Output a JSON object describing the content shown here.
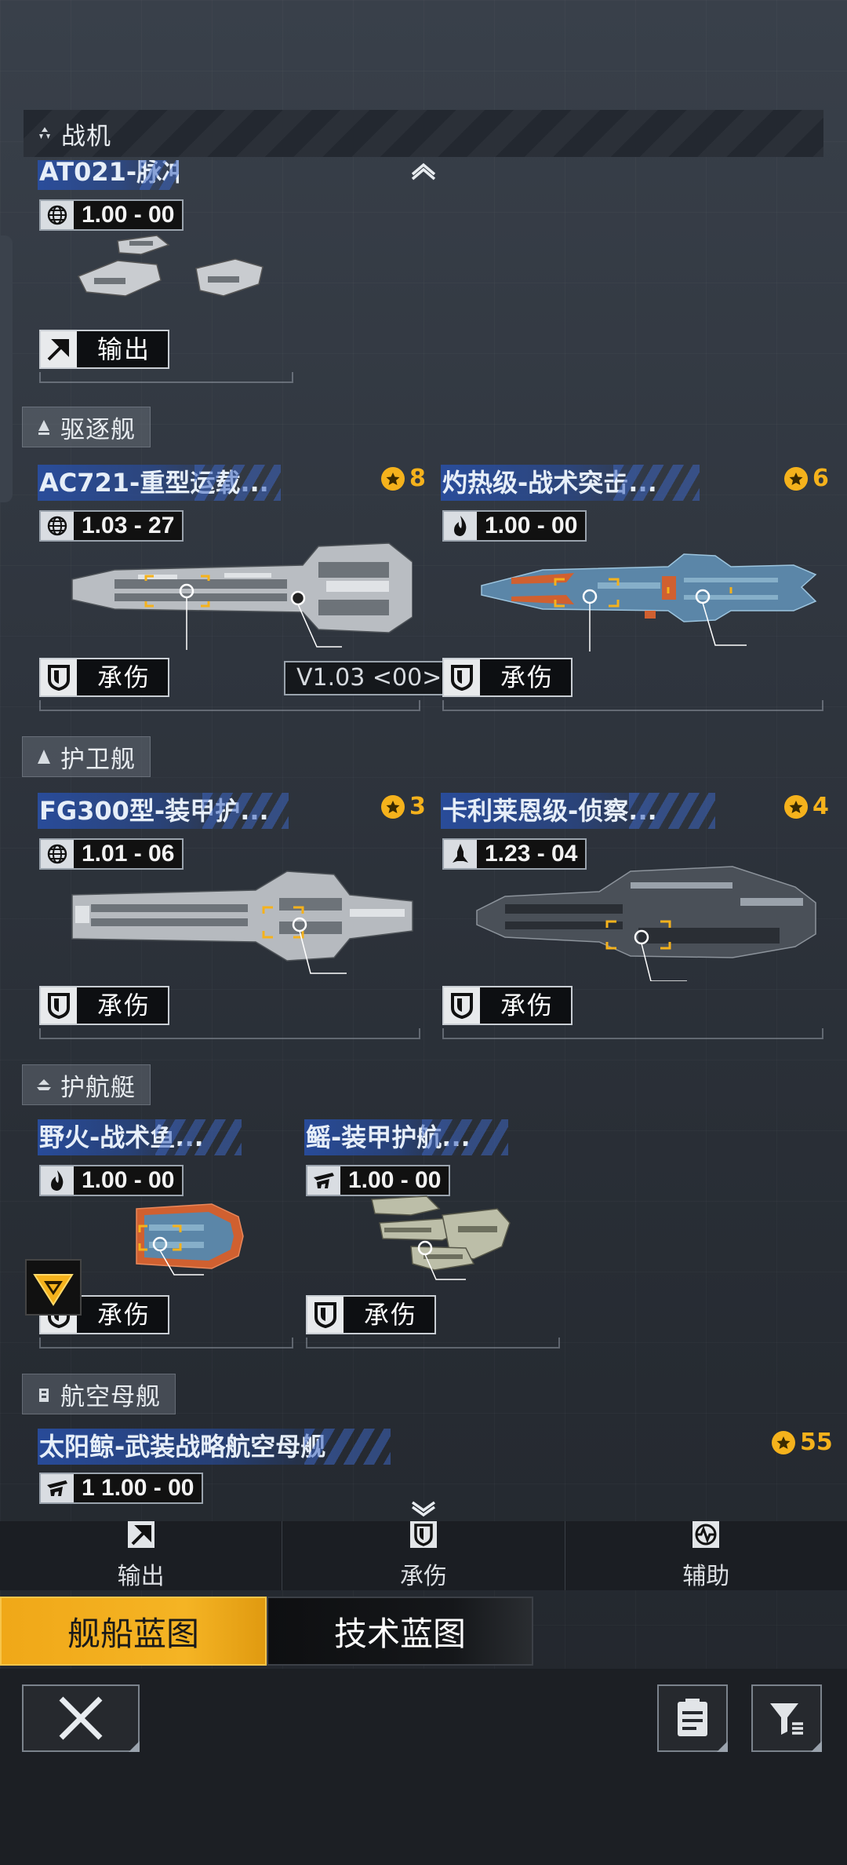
{
  "sections": {
    "fighter": "战机",
    "destroyer": "驱逐舰",
    "frigate": "护卫舰",
    "corvette": "护航艇",
    "carrier": "航空母舰"
  },
  "cards": {
    "fighter1": {
      "name": "AT021-脉冲...",
      "stat": "1.00 - 00",
      "role": "输出"
    },
    "destroyer1": {
      "name": "AC721-重型运载...",
      "rank": "8",
      "stat": "1.03 - 27",
      "role": "承伤",
      "version": "V1.03 <00>"
    },
    "destroyer2": {
      "name": "灼热级-战术突击...",
      "rank": "6",
      "stat": "1.00 - 00",
      "role": "承伤"
    },
    "frigate1": {
      "name": "FG300型-装甲护...",
      "rank": "3",
      "stat": "1.01 - 06",
      "role": "承伤"
    },
    "frigate2": {
      "name": "卡利莱恩级-侦察...",
      "rank": "4",
      "stat": "1.23 - 04",
      "role": "承伤"
    },
    "corvette1": {
      "name": "野火-战术鱼...",
      "stat": "1.00 - 00",
      "role": "承伤"
    },
    "corvette2": {
      "name": "鳐-装甲护航...",
      "stat": "1.00 - 00",
      "role": "承伤"
    },
    "carrier1": {
      "name": "太阳鲸-武装战略航空母舰",
      "rank": "55",
      "stat": "1 1.00 - 00"
    }
  },
  "tabs": {
    "output": "输出",
    "tank": "承伤",
    "support": "辅助"
  },
  "blueprints": {
    "ship": "舰船蓝图",
    "tech": "技术蓝图"
  },
  "colors": {
    "accent": "#f5b21c",
    "name_bar": "#2c55b0",
    "bg": "#2f353e"
  },
  "icons": {
    "close": "close-icon",
    "list": "list-icon",
    "filter": "filter-icon"
  }
}
